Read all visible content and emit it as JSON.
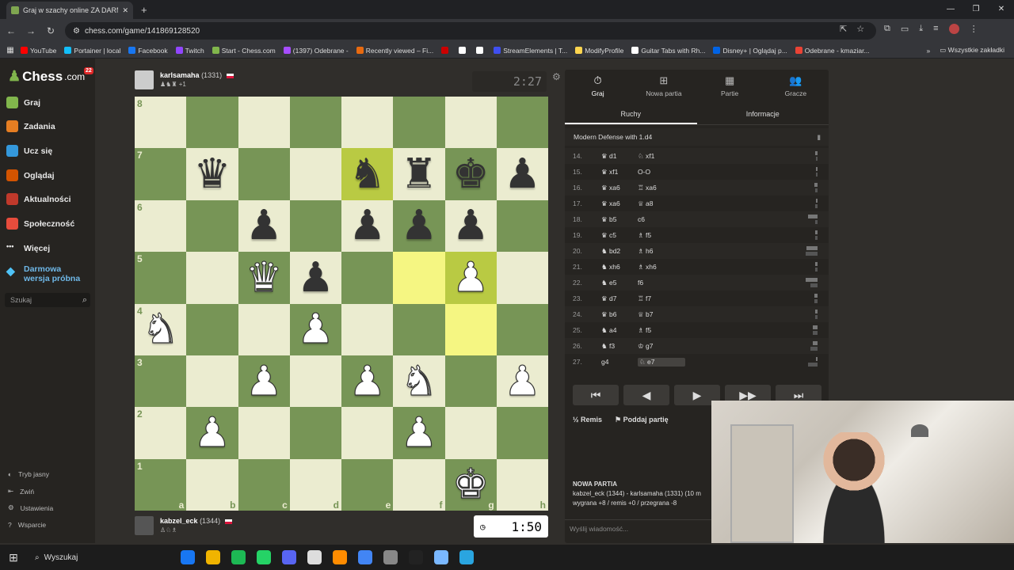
{
  "browser": {
    "tab_title": "Graj w szachy online ZA DARM",
    "tab_close": "✕",
    "new_tab": "+",
    "url": "chess.com/game/141869128520",
    "win": [
      "—",
      "❐",
      "✕"
    ],
    "bookmarks": [
      {
        "label": "YouTube",
        "color": "#ff0000"
      },
      {
        "label": "Portainer | local",
        "color": "#13bef9"
      },
      {
        "label": "Facebook",
        "color": "#1877f2"
      },
      {
        "label": "Twitch",
        "color": "#9146ff"
      },
      {
        "label": "Start - Chess.com",
        "color": "#81b64c"
      },
      {
        "label": "(1397) Odebrane -",
        "color": "#a64dff"
      },
      {
        "label": "Recently viewed – Fi...",
        "color": "#e86a10"
      },
      {
        "label": "",
        "color": "#cc0000"
      },
      {
        "label": "",
        "color": "#ffffff"
      },
      {
        "label": "",
        "color": "#ffffff"
      },
      {
        "label": "StreamElements | T...",
        "color": "#3f4ff0"
      },
      {
        "label": "ModifyProfile",
        "color": "#ffd54f"
      },
      {
        "label": "Guitar Tabs with Rh...",
        "color": "#ffffff"
      },
      {
        "label": "Disney+ | Oglądaj p...",
        "color": "#0063e5"
      },
      {
        "label": "Odebrane - kmaziar...",
        "color": "#ea4335"
      }
    ],
    "bookmarks_more": "»",
    "all_bookmarks": "Wszystkie zakładki"
  },
  "sidebar": {
    "logo": "Chess",
    "logo_suffix": ".com",
    "badge": "22",
    "items": [
      {
        "label": "Graj",
        "color": "#81b64c"
      },
      {
        "label": "Zadania",
        "color": "#e67e22"
      },
      {
        "label": "Ucz się",
        "color": "#3498db"
      },
      {
        "label": "Oglądaj",
        "color": "#d35400"
      },
      {
        "label": "Aktualności",
        "color": "#c0392b"
      },
      {
        "label": "Społeczność",
        "color": "#e74c3c"
      },
      {
        "label": "Więcej",
        "color": "#ffffff"
      }
    ],
    "premium": "Darmowa wersja próbna",
    "search_placeholder": "Szukaj",
    "bottom": [
      "Tryb jasny",
      "Zwiń",
      "Ustawienia",
      "Wsparcie"
    ]
  },
  "players": {
    "top": {
      "name": "karlsamaha",
      "rating": "(1331)",
      "clock": "2:27",
      "sub": "+1"
    },
    "bottom": {
      "name": "kabzel_eck",
      "rating": "(1344)",
      "clock": "1:50"
    }
  },
  "board": {
    "ranks": [
      "8",
      "7",
      "6",
      "5",
      "4",
      "3",
      "2",
      "1"
    ],
    "files": [
      "a",
      "b",
      "c",
      "d",
      "e",
      "f",
      "g",
      "h"
    ],
    "highlight": [
      "e7",
      "f5",
      "g5",
      "g4"
    ],
    "pieces": {
      "b7": "bq",
      "e7": "bn",
      "f7": "br",
      "g7": "bk",
      "h7": "bp",
      "c6": "bp",
      "e6": "bp",
      "f6": "bp",
      "g6": "bp",
      "c5": "wq",
      "d5": "bp",
      "g5": "wp",
      "a4": "wn",
      "d4": "wp",
      "c3": "wp",
      "e3": "wp",
      "f3": "wn",
      "h3": "wp",
      "b2": "wp",
      "f2": "wp",
      "g1": "wk"
    }
  },
  "panel": {
    "tabs": [
      {
        "label": "Graj",
        "icon": "⏱"
      },
      {
        "label": "Nowa partia",
        "icon": "⊞"
      },
      {
        "label": "Partie",
        "icon": "▦"
      },
      {
        "label": "Gracze",
        "icon": "👥"
      }
    ],
    "subtabs": [
      "Ruchy",
      "Informacje"
    ],
    "opening": "Modern Defense with 1.d4",
    "moves": [
      {
        "n": "14.",
        "w": "♛ d1",
        "b": "♘ xf1",
        "t1": 3,
        "t2": 2
      },
      {
        "n": "15.",
        "w": "♛ xf1",
        "b": "O-O",
        "t1": 2,
        "t2": 2
      },
      {
        "n": "16.",
        "w": "♛ xa6",
        "b": "♖ xa6",
        "t1": 4,
        "t2": 3
      },
      {
        "n": "17.",
        "w": "♛ xa6",
        "b": "♕ a8",
        "t1": 2,
        "t2": 3
      },
      {
        "n": "18.",
        "w": "♛ b5",
        "b": "c6",
        "t1": 12,
        "t2": 3
      },
      {
        "n": "19.",
        "w": "♛ c5",
        "b": "♗ f5",
        "t1": 3,
        "t2": 3
      },
      {
        "n": "20.",
        "w": "♞ bd2",
        "b": "♗ h6",
        "t1": 14,
        "t2": 15
      },
      {
        "n": "21.",
        "w": "♞ xh6",
        "b": "♗ xh6",
        "t1": 3,
        "t2": 3
      },
      {
        "n": "22.",
        "w": "♞ e5",
        "b": "f6",
        "t1": 15,
        "t2": 9
      },
      {
        "n": "23.",
        "w": "♛ d7",
        "b": "♖ f7",
        "t1": 4,
        "t2": 4
      },
      {
        "n": "24.",
        "w": "♛ b6",
        "b": "♕ b7",
        "t1": 3,
        "t2": 3
      },
      {
        "n": "25.",
        "w": "♞ a4",
        "b": "♗ f5",
        "t1": 6,
        "t2": 6
      },
      {
        "n": "26.",
        "w": "♞ f3",
        "b": "♔ g7",
        "t1": 6,
        "t2": 9
      },
      {
        "n": "27.",
        "w": "g4",
        "b": "♘ e7",
        "t1": 2,
        "t2": 12,
        "current": true
      }
    ],
    "nav": [
      "⏮",
      "◀",
      "▶",
      "▶▶",
      "⏭"
    ],
    "draw": "Remis",
    "draw_icon": "½",
    "resign": "Poddaj partię",
    "resign_icon": "⚑",
    "newgame_title": "NOWA PARTIA",
    "newgame_line1": "kabzel_eck (1344) - karlsamaha (1331) (10 m",
    "newgame_line2": "wygrana +8 / remis +0 / przegrana -8",
    "chat_placeholder": "Wyślij wiadomość..."
  },
  "taskbar": {
    "start": "⊞",
    "search": "Wyszukaj",
    "apps": [
      "#1877f2",
      "#f0b400",
      "#1db954",
      "#25d366",
      "#5865f2",
      "#dddddd",
      "#ff8c00",
      "#4285f4",
      "#888888",
      "#222222",
      "#7ab8ff",
      "#2aa5e0"
    ]
  }
}
